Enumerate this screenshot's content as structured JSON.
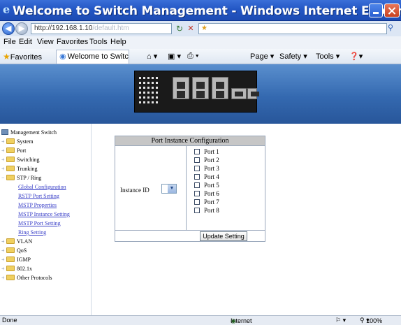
{
  "window": {
    "title": "Welcome to Switch Management - Windows Internet Explorer"
  },
  "address": {
    "url": "http://192.168.1.10",
    "url_tail": "/default.htm"
  },
  "menu": [
    "File",
    "Edit",
    "View",
    "Favorites",
    "Tools",
    "Help"
  ],
  "command_bar": {
    "favorites_label": "Favorites",
    "tab_label": "Welcome to Switch ...",
    "buttons": [
      "Page ▾",
      "Safety ▾",
      "Tools ▾"
    ]
  },
  "sidebar": {
    "root": "Management Switch",
    "items": [
      {
        "label": "System",
        "type": "folder"
      },
      {
        "label": "Port",
        "type": "folder"
      },
      {
        "label": "Switching",
        "type": "folder"
      },
      {
        "label": "Trunking",
        "type": "folder"
      },
      {
        "label": "STP / Ring",
        "type": "folder-open"
      },
      {
        "label": "Global Configuration",
        "type": "link"
      },
      {
        "label": "RSTP Port Setting",
        "type": "link"
      },
      {
        "label": "MSTP Properties",
        "type": "link"
      },
      {
        "label": "MSTP Instance Setting",
        "type": "link"
      },
      {
        "label": "MSTP Port Setting",
        "type": "link"
      },
      {
        "label": "Ring Setting",
        "type": "link"
      },
      {
        "label": "VLAN",
        "type": "folder"
      },
      {
        "label": "QoS",
        "type": "folder"
      },
      {
        "label": "IGMP",
        "type": "folder"
      },
      {
        "label": "802.1x",
        "type": "folder"
      },
      {
        "label": "Other Protocols",
        "type": "folder"
      }
    ]
  },
  "panel": {
    "title": "Port Instance Configuration",
    "instance_label": "Instance ID",
    "ports": [
      "Port 1",
      "Port 2",
      "Port 3",
      "Port 4",
      "Port 5",
      "Port 6",
      "Port 7",
      "Port 8"
    ],
    "update_button": "Update Setting"
  },
  "status": {
    "left": "Done",
    "zone": "Internet",
    "zoom": "100%"
  },
  "colors": {
    "titlebar": "#2457c5",
    "banner": "#3469b0",
    "panel_header": "#c6c6c6",
    "link": "#3a40c8"
  }
}
